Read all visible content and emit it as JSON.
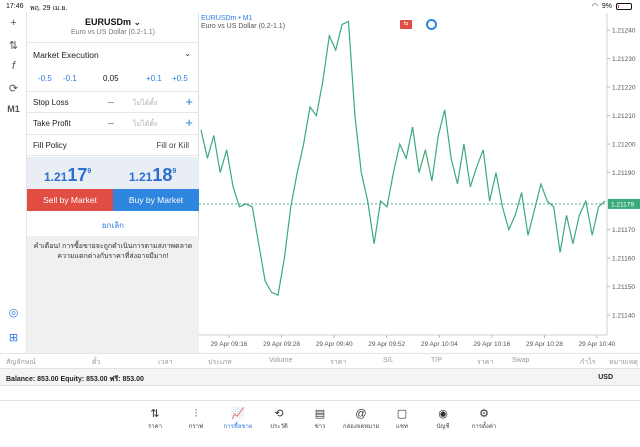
{
  "status": {
    "time": "17:46",
    "date": "พฤ. 29 เม.ย.",
    "battery": "9%"
  },
  "symbol": {
    "name": "EURUSDm",
    "desc": "Euro vs US Dollar (0.2-1.1)"
  },
  "order": {
    "execution": "Market Execution",
    "volume": {
      "m05": "-0.5",
      "m01": "-0.1",
      "value": "0.05",
      "p01": "+0.1",
      "p05": "+0.5"
    },
    "stop_loss_label": "Stop Loss",
    "take_profit_label": "Take Profit",
    "placeholder": "ไม่ได้ตั้ง",
    "fill_label": "Fill Policy",
    "fill_value": "Fill or Kill",
    "sell_quote": {
      "pre": "1.21",
      "big": "17",
      "sup": "9"
    },
    "buy_quote": {
      "pre": "1.21",
      "big": "18",
      "sup": "9"
    },
    "sell_label": "Sell by Market",
    "buy_label": "Buy by Market",
    "cancel_label": "ยกเลิก",
    "warning": "คำเตือน! การซื้อขายจะถูกดำเนินการตามสภาพตลาด ความแตกต่างกับราคาที่ส่งอาจมีมาก!"
  },
  "left_tools": [
    "+",
    "⇅",
    "f",
    "⟳",
    "M1"
  ],
  "chart_info": {
    "symbol": "EURUSDm • M1",
    "desc": "Euro vs US Dollar (0.2-1.1)"
  },
  "columns": [
    "สัญลักษณ์",
    "ตั๋ว",
    "เวลา",
    "ประเภท",
    "Volume",
    "ราคา",
    "S/L",
    "T/P",
    "ราคา",
    "Swap",
    "กำไร",
    "หมายเหตุ"
  ],
  "balance": {
    "text": "Balance: 853.00  Equity: 853.00  ฟรี: 853.00",
    "currency": "USD"
  },
  "tabs": [
    {
      "icon": "⇅",
      "label": "ราคา"
    },
    {
      "icon": "⫶",
      "label": "กราฟ"
    },
    {
      "icon": "📈",
      "label": "การซื้อขาย"
    },
    {
      "icon": "⟲",
      "label": "ประวัติ"
    },
    {
      "icon": "▤",
      "label": "ข่าว"
    },
    {
      "icon": "@",
      "label": "กล่องจดหมาย"
    },
    {
      "icon": "▢",
      "label": "แชท"
    },
    {
      "icon": "◉",
      "label": "บัญชี"
    },
    {
      "icon": "⚙",
      "label": "การตั้งค่า"
    }
  ],
  "accent": "#2b7de1",
  "sell_color": "#e04d42",
  "buy_color": "#2f86de",
  "line_color": "#3aaa7a",
  "chart_data": {
    "type": "line",
    "title": "",
    "x_ticks": [
      "29 Apr 09:16",
      "29 Apr 09:28",
      "29 Apr 09:40",
      "29 Apr 09:52",
      "29 Apr 10:04",
      "29 Apr 10:16",
      "29 Apr 10:28",
      "29 Apr 10:40"
    ],
    "y_ticks": [
      "1.21240",
      "1.21230",
      "1.21220",
      "1.21210",
      "1.21200",
      "1.21190",
      "1.21180",
      "1.21170",
      "1.21160",
      "1.21150",
      "1.21140"
    ],
    "ylim": [
      1.21133,
      1.21246
    ],
    "current_price": "1.21179",
    "series": [
      {
        "values": [
          1.21205,
          1.21195,
          1.21203,
          1.2119,
          1.21198,
          1.21185,
          1.21178,
          1.21179,
          1.21178,
          1.21165,
          1.21152,
          1.21148,
          1.21147,
          1.2116,
          1.21178,
          1.2119,
          1.212,
          1.21213,
          1.2121,
          1.21222,
          1.21238,
          1.21233,
          1.21242,
          1.21243,
          1.2121,
          1.2119,
          1.2118,
          1.21165,
          1.2118,
          1.21178,
          1.2119,
          1.212,
          1.21195,
          1.21206,
          1.2119,
          1.21198,
          1.21187,
          1.21203,
          1.21212,
          1.21195,
          1.21186,
          1.212,
          1.21185,
          1.21192,
          1.21198,
          1.2118,
          1.2119,
          1.21178,
          1.2117,
          1.21175,
          1.21183,
          1.21168,
          1.21177,
          1.21186,
          1.2118,
          1.21178,
          1.21162,
          1.21175,
          1.21165,
          1.21175,
          1.2118,
          1.21168,
          1.21178,
          1.2118
        ]
      }
    ]
  }
}
